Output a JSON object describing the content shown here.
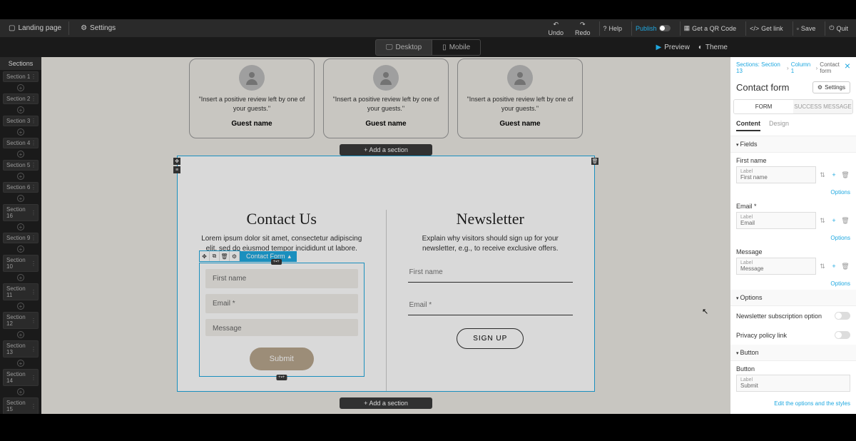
{
  "toolbar": {
    "landing_page": "Landing page",
    "settings": "Settings",
    "undo": "Undo",
    "redo": "Redo",
    "help": "Help",
    "publish": "Publish",
    "qr": "Get a QR Code",
    "getlink": "Get link",
    "save": "Save",
    "quit": "Quit"
  },
  "viewbar": {
    "desktop": "Desktop",
    "mobile": "Mobile",
    "preview": "Preview",
    "theme": "Theme"
  },
  "sections": {
    "header": "Sections",
    "items": [
      "Section 1",
      "Section 2",
      "Section 3",
      "Section 4",
      "Section 5",
      "Section 6",
      "Section 16",
      "Section 9",
      "Section 10",
      "Section 11",
      "Section 12",
      "Section 13",
      "Section 14",
      "Section 15"
    ]
  },
  "canvas": {
    "review_text": "\"Insert a positive review left by one of your guests.\"",
    "review_name": "Guest name",
    "add_section": "+   Add a section",
    "contact": {
      "title": "Contact Us",
      "desc": "Lorem ipsum dolor sit amet, consectetur adipiscing elit, sed do eiusmod tempor incididunt ut labore.",
      "first_name": "First name",
      "email": "Email *",
      "message": "Message",
      "submit": "Submit",
      "sel_label": "Contact Form"
    },
    "newsletter": {
      "title": "Newsletter",
      "desc": "Explain why visitors should sign up for your newsletter, e.g., to receive exclusive offers.",
      "first_name": "First name",
      "email": "Email *",
      "signup": "SIGN UP"
    }
  },
  "side_tabs": {
    "content": "CONTENT",
    "design": "DESIGN"
  },
  "rp": {
    "crumb1": "Sections: Section 13",
    "crumb2": "Column 1",
    "crumb3": "Contact form",
    "title": "Contact form",
    "settings_btn": "Settings",
    "tab_form": "FORM",
    "tab_success": "SUCCESS MESSAGE",
    "subtab_content": "Content",
    "subtab_design": "Design",
    "fields_head": "Fields",
    "fields": [
      {
        "name": "First name",
        "label": "Label",
        "value": "First name"
      },
      {
        "name": "Email *",
        "label": "Label",
        "value": "Email"
      },
      {
        "name": "Message",
        "label": "Label",
        "value": "Message"
      }
    ],
    "options_head": "Options",
    "options_link": "Options",
    "opt_newsletter": "Newsletter subscription option",
    "opt_privacy": "Privacy policy link",
    "button_head": "Button",
    "button_label": "Button",
    "button_sub": "Label",
    "button_val": "Submit",
    "edit_link": "Edit the options and the styles"
  }
}
